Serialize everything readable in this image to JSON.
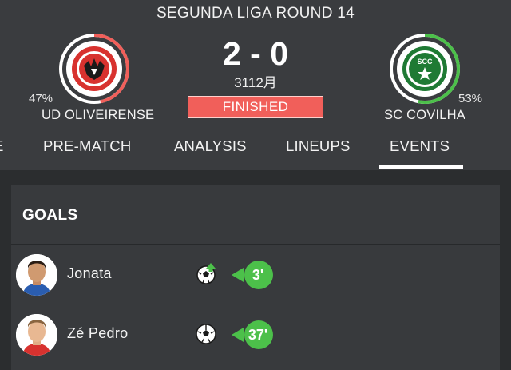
{
  "match": {
    "round_title": "SEGUNDA LIGA ROUND 14",
    "score": "2 - 0",
    "date": "3112月",
    "status": "FINISHED"
  },
  "home": {
    "name": "UD OLIVEIRENSE",
    "possession_label": "47%",
    "possession_fraction": 0.47,
    "ring_color": "#f15f5a"
  },
  "away": {
    "name": "SC COVILHA",
    "possession_label": "53%",
    "possession_fraction": 0.53,
    "ring_color": "#4cc04a",
    "crest_text": "SCC"
  },
  "tabs": [
    {
      "label": "E"
    },
    {
      "label": "PRE-MATCH"
    },
    {
      "label": "ANALYSIS"
    },
    {
      "label": "LINEUPS"
    },
    {
      "label": "EVENTS",
      "active": true
    }
  ],
  "goals": {
    "title": "GOALS",
    "items": [
      {
        "player": "Jonata",
        "minute": "3'",
        "icon": "soccer-ball-assist-icon"
      },
      {
        "player": "Zé Pedro",
        "minute": "37'",
        "icon": "soccer-ball-icon"
      }
    ]
  },
  "colors": {
    "accent_green": "#4cc04a",
    "accent_red": "#f15f5a",
    "header_bg": "#3a3c3f",
    "page_bg": "#2b2d2f"
  }
}
